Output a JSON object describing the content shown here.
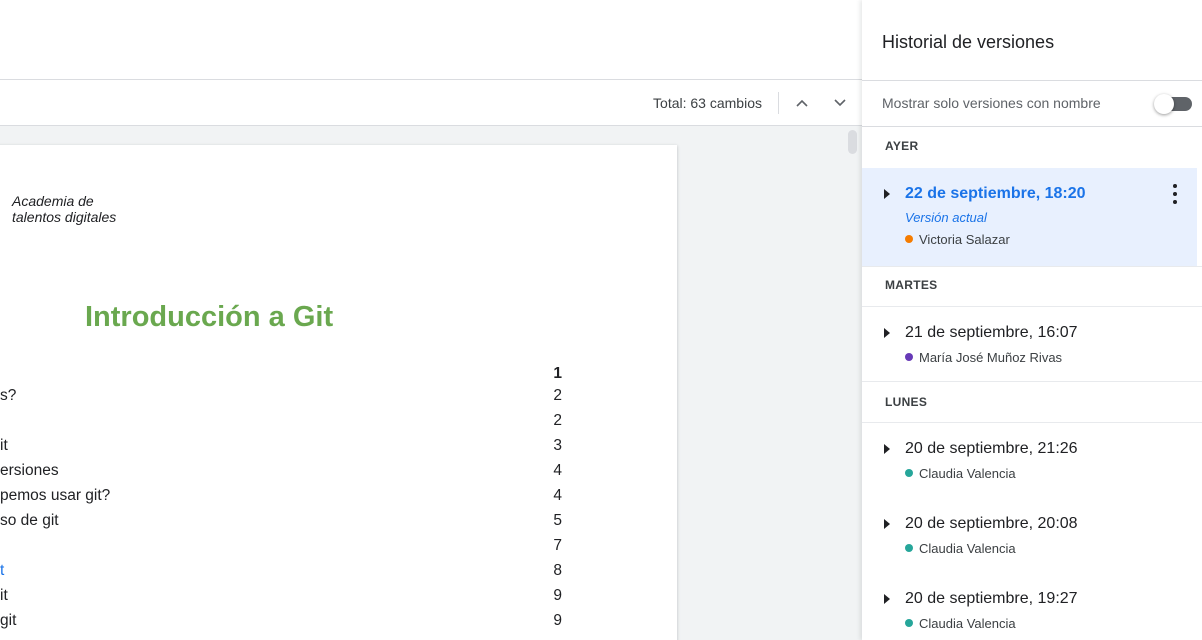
{
  "toolbar": {
    "total_changes": "Total: 63 cambios"
  },
  "document": {
    "logo_line1": "Academia de",
    "logo_line2": "talentos digitales",
    "title": "Introducción a Git",
    "toc": [
      {
        "text": "",
        "page": "1"
      },
      {
        "text": "s?",
        "page": "2"
      },
      {
        "text": "",
        "page": "2"
      },
      {
        "text": "it",
        "page": "3"
      },
      {
        "text": "ersiones",
        "page": "4"
      },
      {
        "text": "pemos usar git?",
        "page": "4"
      },
      {
        "text": "so de git",
        "page": "5"
      },
      {
        "text": "",
        "page": "7"
      },
      {
        "text": "t",
        "page": "8"
      },
      {
        "text": "it",
        "page": "9"
      },
      {
        "text": "git",
        "page": "9"
      }
    ]
  },
  "panel": {
    "title": "Historial de versiones",
    "filter_label": "Mostrar solo versiones con nombre",
    "groups": [
      {
        "label": "AYER"
      },
      {
        "label": "MARTES"
      },
      {
        "label": "LUNES"
      }
    ],
    "versions": [
      {
        "date": "22 de septiembre, 18:20",
        "subtitle": "Versión actual",
        "author": "Victoria Salazar",
        "author_color": "#f57c00"
      },
      {
        "date": "21 de septiembre, 16:07",
        "author": "María José Muñoz Rivas",
        "author_color": "#673ab7"
      },
      {
        "date": "20 de septiembre, 21:26",
        "author": "Claudia Valencia",
        "author_color": "#26a69a"
      },
      {
        "date": "20 de septiembre, 20:08",
        "author": "Claudia Valencia",
        "author_color": "#26a69a"
      },
      {
        "date": "20 de septiembre, 19:27",
        "author": "Claudia Valencia",
        "author_color": "#26a69a"
      }
    ]
  }
}
